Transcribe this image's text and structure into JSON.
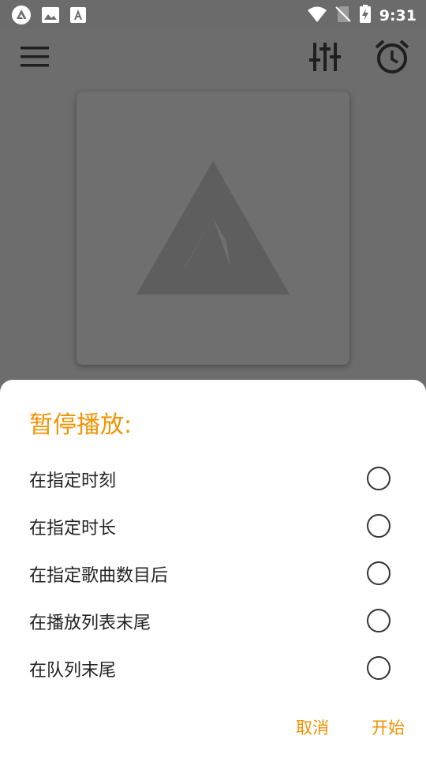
{
  "status_bar": {
    "time": "9:31",
    "icons": [
      "app-logo-icon",
      "image-icon",
      "font-icon",
      "wifi-icon",
      "no-sim-icon",
      "battery-charging-icon"
    ]
  },
  "app_bar": {
    "icons": [
      "menu-icon",
      "equalizer-icon",
      "alarm-clock-icon"
    ]
  },
  "sheet": {
    "title": "暂停播放:",
    "options": [
      {
        "label": "在指定时刻",
        "selected": false
      },
      {
        "label": "在指定时长",
        "selected": false
      },
      {
        "label": "在指定歌曲数目后",
        "selected": false
      },
      {
        "label": "在播放列表末尾",
        "selected": false
      },
      {
        "label": "在队列末尾",
        "selected": false
      }
    ],
    "cancel_label": "取消",
    "start_label": "开始"
  },
  "colors": {
    "accent": "#f39200",
    "scrim": "#6d6d6d",
    "sheet_bg": "#ffffff"
  }
}
